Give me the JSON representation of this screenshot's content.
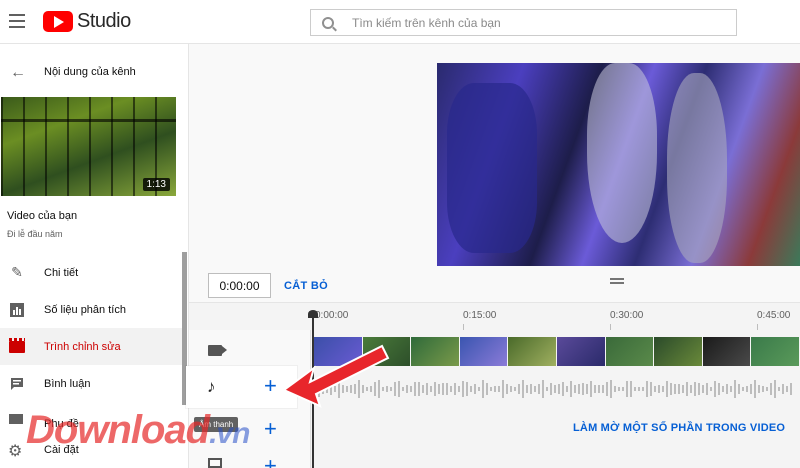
{
  "app": {
    "logo_text": "Studio"
  },
  "search": {
    "placeholder": "Tìm kiếm trên kênh của bạn"
  },
  "sidebar": {
    "back_label": "Nội dung của kênh",
    "video": {
      "duration": "1:13",
      "title": "Video của bạn",
      "subtitle": "Đi lễ đầu năm"
    },
    "items": [
      {
        "label": "Chi tiết",
        "icon": "pencil-icon"
      },
      {
        "label": "Số liệu phân tích",
        "icon": "analytics-icon"
      },
      {
        "label": "Trình chỉnh sửa",
        "icon": "clapperboard-icon",
        "active": true
      },
      {
        "label": "Bình luận",
        "icon": "comment-icon"
      },
      {
        "label": "Phụ đề",
        "icon": "subtitles-icon"
      }
    ],
    "settings_label": "Cài đặt"
  },
  "editor": {
    "current_time": "0:00:00",
    "cut_label": "CẮT BỎ",
    "ruler": [
      "0:00:00",
      "0:15:00",
      "0:30:00",
      "0:45:00"
    ],
    "audio_tooltip": "Âm thanh",
    "blur_label": "LÀM MỜ MỘT SỐ PHẦN TRONG VIDEO"
  },
  "watermark": {
    "main": "Download",
    "suffix": ".vn"
  },
  "colors": {
    "accent": "#065fd4",
    "active": "#cc0000",
    "arrow": "#e8262b"
  }
}
